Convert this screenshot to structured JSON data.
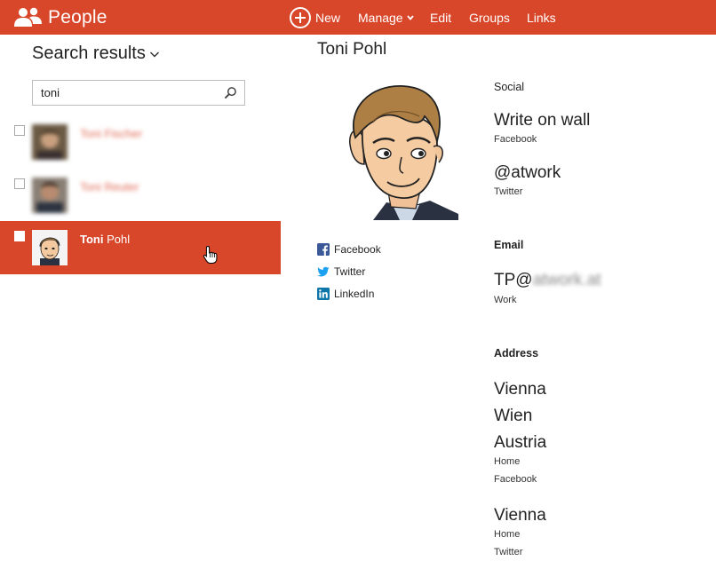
{
  "app": {
    "title": "People"
  },
  "nav": {
    "new": "New",
    "manage": "Manage",
    "edit": "Edit",
    "groups": "Groups",
    "links": "Links"
  },
  "search": {
    "heading": "Search results",
    "value": "toni",
    "placeholder": ""
  },
  "results": [
    {
      "name": "Toni Fischer",
      "selected": false
    },
    {
      "name": "Toni Reuter",
      "selected": false
    },
    {
      "first": "Toni",
      "last": "Pohl",
      "selected": true
    }
  ],
  "contact": {
    "name": "Toni Pohl",
    "links": [
      "Facebook",
      "Twitter",
      "LinkedIn"
    ],
    "social": {
      "heading": "Social",
      "entries": [
        {
          "value": "Write on wall",
          "source": "Facebook"
        },
        {
          "value": "@atwork",
          "source": "Twitter"
        }
      ]
    },
    "email": {
      "heading": "Email",
      "prefix": "TP@",
      "domain": "atwork.at",
      "type": "Work"
    },
    "address": {
      "heading": "Address",
      "entries": [
        {
          "lines": [
            "Vienna",
            "Wien",
            "Austria"
          ],
          "type": "Home",
          "source": "Facebook"
        },
        {
          "lines": [
            "Vienna"
          ],
          "type": "Home",
          "source": "Twitter"
        }
      ]
    }
  },
  "colors": {
    "accent": "#d9472b",
    "facebook": "#3b5998",
    "twitter": "#1da1f2",
    "linkedin": "#0e76a8"
  }
}
